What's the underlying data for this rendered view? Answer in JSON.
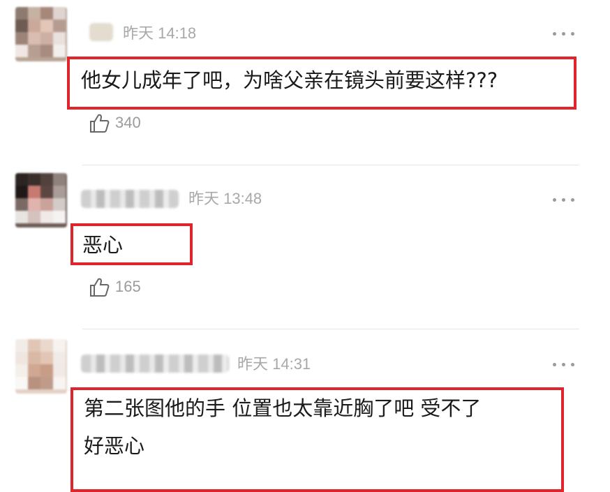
{
  "comments": [
    {
      "time": "昨天 14:18",
      "text": "他女儿成年了吧，为啥父亲在镜头前要这样???",
      "likes": "340"
    },
    {
      "time": "昨天 13:48",
      "text": "恶心",
      "likes": "165"
    },
    {
      "time": "昨天 14:31",
      "text_line1": "第二张图他的手 位置也太靠近胸了吧 受不了",
      "text_line2": "好恶心"
    }
  ],
  "colors": {
    "highlight_border": "#e0242c",
    "meta_text": "#a8a8a8",
    "divider": "#e6e6e6"
  },
  "icons": [
    "thumbs-up-icon",
    "more-options-icon",
    "avatar"
  ]
}
